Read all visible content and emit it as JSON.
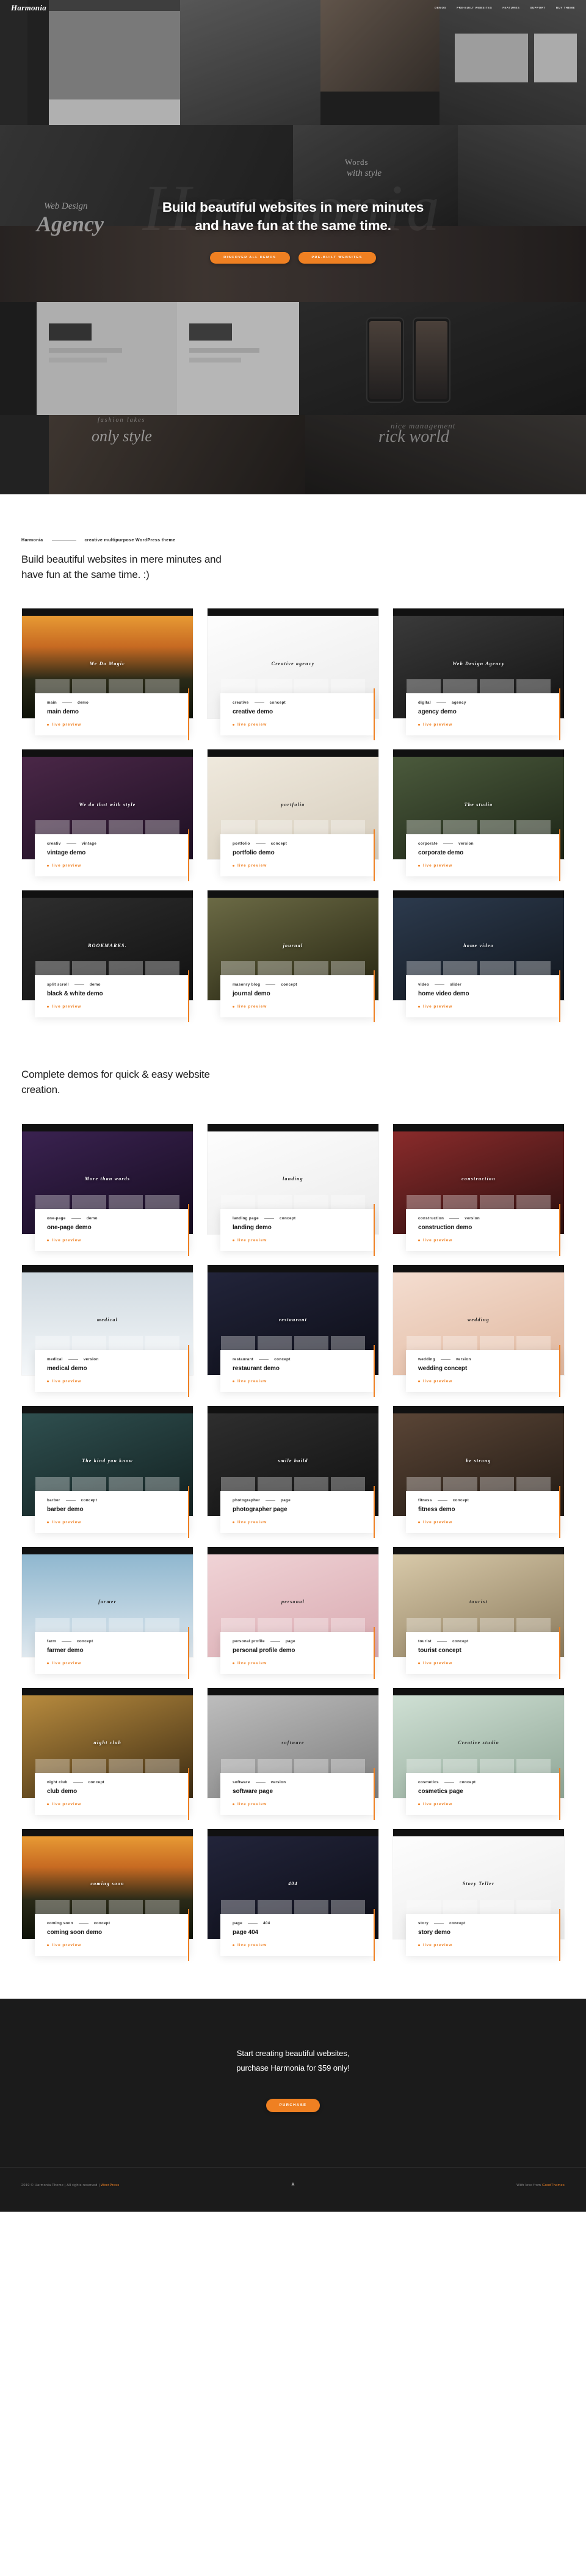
{
  "site": {
    "brand": "Harmonia",
    "accent": "#ef8022",
    "dark": "#1b1b1b"
  },
  "nav": {
    "items": [
      {
        "label": "DEMOS"
      },
      {
        "label": "PRE-BUILT WEBSITES"
      },
      {
        "label": "FEATURES"
      },
      {
        "label": "SUPPORT"
      },
      {
        "label": "BUY THEME"
      }
    ]
  },
  "hero": {
    "title_line1": "Build beautiful websites in mere minutes",
    "title_line2": "and have fun at the same time.",
    "primary_button": "DISCOVER ALL DEMOS",
    "secondary_button": "PRE-BUILT WEBSITES",
    "collage_words": {
      "agency_script": "Agency",
      "web_design": "Web Design",
      "words_with": "Words",
      "with_style": "with style",
      "only_style": "only style",
      "fashion_lakes": "fashion lakes",
      "nice_world": "rick world",
      "nice_small": "nice management",
      "watermark": "Harmonia"
    }
  },
  "section_demos": {
    "eyebrow_brand": "Harmonia",
    "eyebrow_sub": "creative multipurpose WordPress theme",
    "title": "Build beautiful websites in mere minutes and have fun at the same time. :)",
    "live_preview_label": "live preview",
    "cards": [
      {
        "tag_left": "main",
        "tag_right": "demo",
        "title": "main demo",
        "art": "t-sunset",
        "shot_title": "We Do Magic"
      },
      {
        "tag_left": "creative",
        "tag_right": "concept",
        "title": "creative demo",
        "art": "t-white",
        "shot_title": "Creative agency"
      },
      {
        "tag_left": "digital",
        "tag_right": "agency",
        "title": "agency demo",
        "art": "t-dark",
        "shot_title": "Web Design Agency"
      },
      {
        "tag_left": "creativ",
        "tag_right": "vintage",
        "title": "vintage demo",
        "art": "t-purple",
        "shot_title": "We do that with style"
      },
      {
        "tag_left": "portfolio",
        "tag_right": "concept",
        "title": "portfolio demo",
        "art": "t-cream",
        "shot_title": "portfolio"
      },
      {
        "tag_left": "corporate",
        "tag_right": "version",
        "title": "corporate demo",
        "art": "t-forest",
        "shot_title": "The studio"
      },
      {
        "tag_left": "split scroll",
        "tag_right": "demo",
        "title": "black & white demo",
        "art": "t-charc",
        "shot_title": "BOOKMARKS."
      },
      {
        "tag_left": "masonry blog",
        "tag_right": "concept",
        "title": "journal demo",
        "art": "t-olive",
        "shot_title": "journal"
      },
      {
        "tag_left": "video",
        "tag_right": "slider",
        "title": "home video demo",
        "art": "t-blue",
        "shot_title": "home video"
      }
    ]
  },
  "section_complete": {
    "title": "Complete demos for quick & easy website creation.",
    "live_preview_label": "live preview",
    "cards": [
      {
        "tag_left": "one-page",
        "tag_right": "demo",
        "title": "one-page demo",
        "art": "t-violet",
        "shot_title": "More than words"
      },
      {
        "tag_left": "landing page",
        "tag_right": "concept",
        "title": "landing demo",
        "art": "t-white",
        "shot_title": "landing"
      },
      {
        "tag_left": "construction",
        "tag_right": "version",
        "title": "construction demo",
        "art": "t-red",
        "shot_title": "construction"
      },
      {
        "tag_left": "medical",
        "tag_right": "version",
        "title": "medical demo",
        "art": "t-snow",
        "shot_title": "medical"
      },
      {
        "tag_left": "restaurant",
        "tag_right": "concept",
        "title": "restaurant demo",
        "art": "t-night",
        "shot_title": "restaurant"
      },
      {
        "tag_left": "wedding",
        "tag_right": "version",
        "title": "wedding concept",
        "art": "t-peach",
        "shot_title": "wedding"
      },
      {
        "tag_left": "barber",
        "tag_right": "concept",
        "title": "barber demo",
        "art": "t-teal",
        "shot_title": "The kind you know"
      },
      {
        "tag_left": "photographer",
        "tag_right": "page",
        "title": "photographer page",
        "art": "t-charc",
        "shot_title": "smile build"
      },
      {
        "tag_left": "fitness",
        "tag_right": "concept",
        "title": "fitness demo",
        "art": "t-brown",
        "shot_title": "be strong"
      },
      {
        "tag_left": "farm",
        "tag_right": "concept",
        "title": "farmer demo",
        "art": "t-sky",
        "shot_title": "farmer"
      },
      {
        "tag_left": "personal profile",
        "tag_right": "page",
        "title": "personal profile demo",
        "art": "t-pink",
        "shot_title": "personal"
      },
      {
        "tag_left": "tourist",
        "tag_right": "concept",
        "title": "tourist concept",
        "art": "t-sand",
        "shot_title": "tourist"
      },
      {
        "tag_left": "night club",
        "tag_right": "concept",
        "title": "club demo",
        "art": "t-gold",
        "shot_title": "night club"
      },
      {
        "tag_left": "software",
        "tag_right": "version",
        "title": "software page",
        "art": "t-grey",
        "shot_title": "software"
      },
      {
        "tag_left": "cosmetics",
        "tag_right": "concept",
        "title": "cosmetics page",
        "art": "t-mint",
        "shot_title": "Creative studio"
      },
      {
        "tag_left": "coming soon",
        "tag_right": "concept",
        "title": "coming soon demo",
        "art": "t-sunset",
        "shot_title": "coming soon"
      },
      {
        "tag_left": "page",
        "tag_right": "404",
        "title": "page 404",
        "art": "t-night",
        "shot_title": "404"
      },
      {
        "tag_left": "story",
        "tag_right": "concept",
        "title": "story demo",
        "art": "t-white",
        "shot_title": "Story Teller"
      }
    ]
  },
  "cta": {
    "line1": "Start creating beautiful websites,",
    "line2": "purchase Harmonia for $59 only!",
    "button": "PURCHASE"
  },
  "footer": {
    "left_text": "2019 © Harmonia Theme | All rights reserved | ",
    "left_link": "WordPress",
    "right_text": "With love from ",
    "right_link": "GoodThemes",
    "to_top_icon": "chevron-up-icon"
  }
}
